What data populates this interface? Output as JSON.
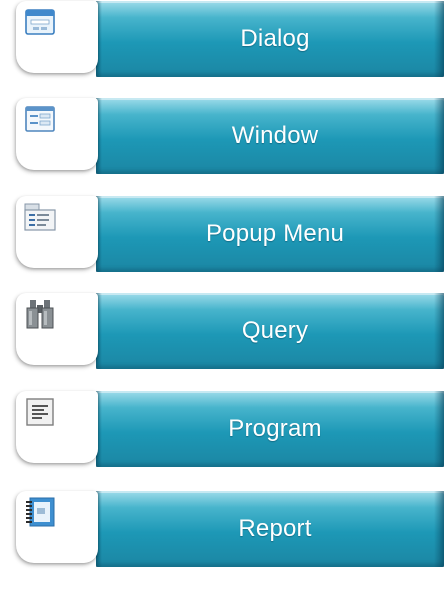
{
  "menu": {
    "items": [
      {
        "label": "Dialog",
        "icon": "dialog-window-icon"
      },
      {
        "label": "Window",
        "icon": "window-form-icon"
      },
      {
        "label": "Popup Menu",
        "icon": "popup-menu-icon"
      },
      {
        "label": "Query",
        "icon": "binoculars-icon"
      },
      {
        "label": "Program",
        "icon": "text-document-icon"
      },
      {
        "label": "Report",
        "icon": "notebook-report-icon"
      }
    ]
  },
  "colors": {
    "bar_teal": "#1d98b6",
    "bar_highlight": "#9fdcea",
    "label_text": "#ffffff",
    "tile_background": "#ffffff"
  }
}
